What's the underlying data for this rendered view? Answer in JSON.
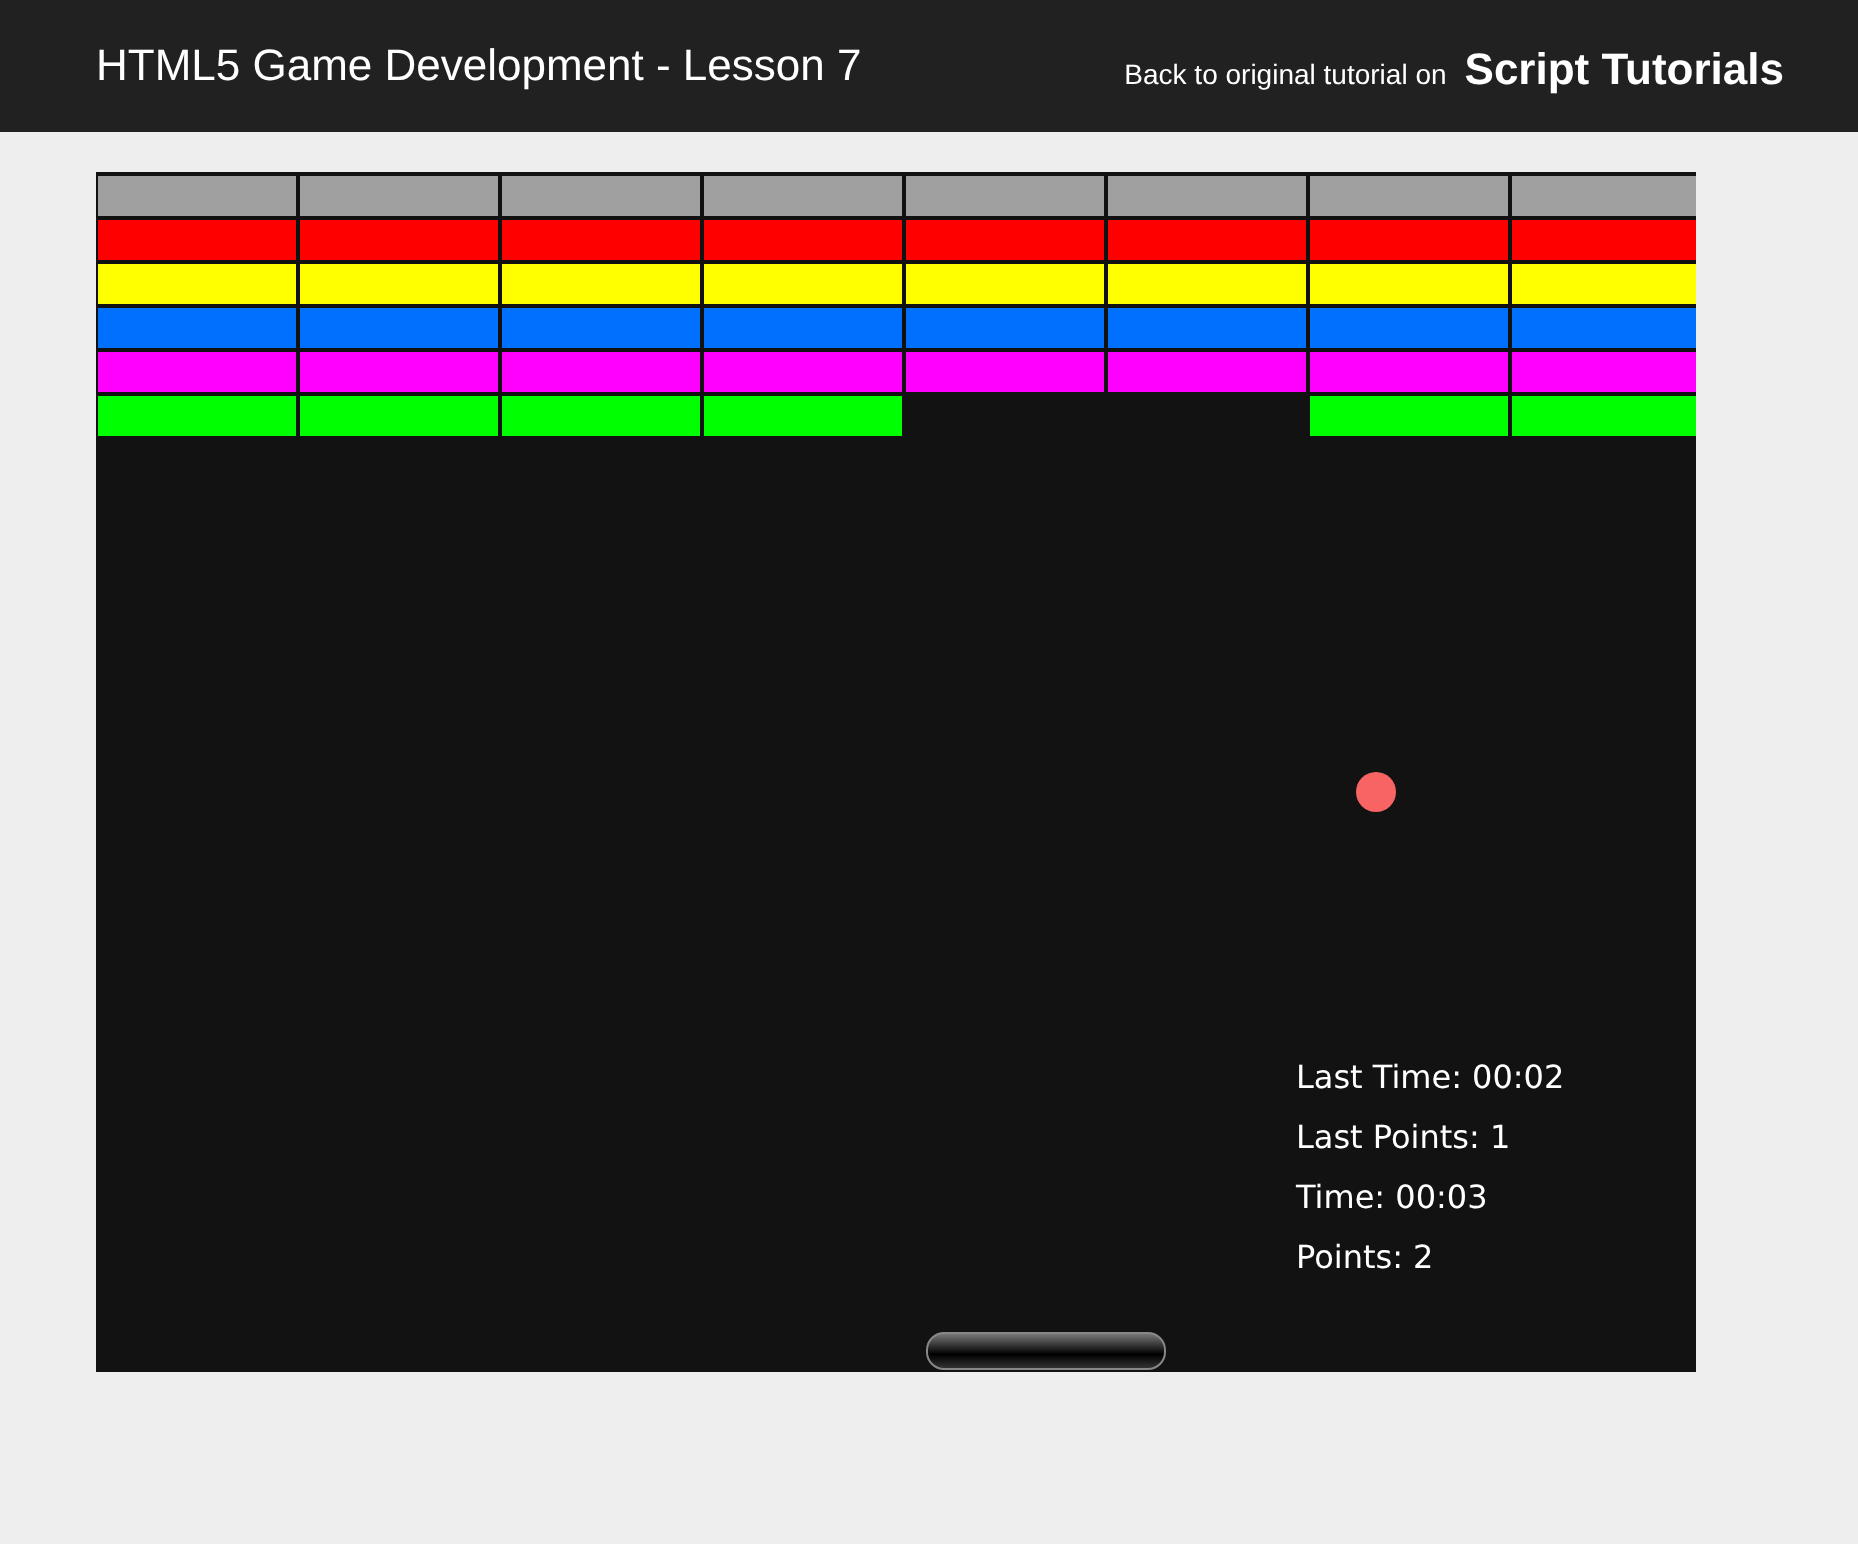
{
  "header": {
    "title": "HTML5 Game Development - Lesson 7",
    "back_text": "Back to original tutorial on",
    "link": "Script Tutorials"
  },
  "brick_rows": [
    {
      "color": "#a0a0a0",
      "bricks": [
        {
          "broken": false
        },
        {
          "broken": false
        },
        {
          "broken": false
        },
        {
          "broken": false
        },
        {
          "broken": false
        },
        {
          "broken": false
        },
        {
          "broken": false
        },
        {
          "broken": false
        }
      ]
    },
    {
      "color": "#ff0000",
      "bricks": [
        {
          "broken": false
        },
        {
          "broken": false
        },
        {
          "broken": false
        },
        {
          "broken": false
        },
        {
          "broken": false
        },
        {
          "broken": false
        },
        {
          "broken": false
        },
        {
          "broken": false
        }
      ]
    },
    {
      "color": "#ffff00",
      "bricks": [
        {
          "broken": false
        },
        {
          "broken": false
        },
        {
          "broken": false
        },
        {
          "broken": false
        },
        {
          "broken": false
        },
        {
          "broken": false
        },
        {
          "broken": false
        },
        {
          "broken": false
        }
      ]
    },
    {
      "color": "#0070ff",
      "bricks": [
        {
          "broken": false
        },
        {
          "broken": false
        },
        {
          "broken": false
        },
        {
          "broken": false
        },
        {
          "broken": false
        },
        {
          "broken": false
        },
        {
          "broken": false
        },
        {
          "broken": false
        }
      ]
    },
    {
      "color": "#ff00ff",
      "bricks": [
        {
          "broken": false
        },
        {
          "broken": false
        },
        {
          "broken": false
        },
        {
          "broken": false
        },
        {
          "broken": false
        },
        {
          "broken": false
        },
        {
          "broken": false
        },
        {
          "broken": false
        }
      ]
    },
    {
      "color": "#00ff00",
      "bricks": [
        {
          "broken": false
        },
        {
          "broken": false
        },
        {
          "broken": false
        },
        {
          "broken": false
        },
        {
          "broken": true
        },
        {
          "broken": true
        },
        {
          "broken": false
        },
        {
          "broken": false
        }
      ]
    }
  ],
  "stats": [
    "Last Time: 00:02",
    "Last Points: 1",
    "Time: 00:03",
    "Points: 2"
  ]
}
